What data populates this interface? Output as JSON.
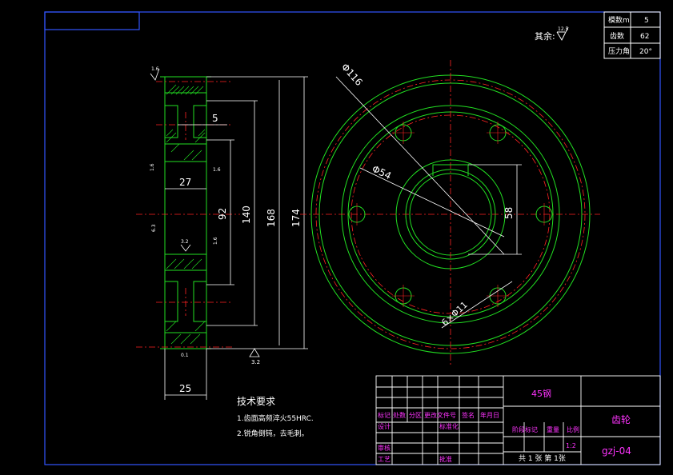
{
  "params": {
    "module_label": "模数m",
    "module_value": "5",
    "teeth_label": "齿数",
    "teeth_value": "62",
    "angle_label": "压力角",
    "angle_value": "20°"
  },
  "surface_note": {
    "label": "其余:",
    "roughness": "12.5"
  },
  "dims": {
    "d116": "Φ116",
    "d54": "Φ54",
    "holes": "6×Φ11",
    "v58": "58",
    "v5": "5",
    "v27": "27",
    "v92": "92",
    "v140": "140",
    "v168": "168",
    "v174": "174",
    "v25": "25"
  },
  "roughness_marks": {
    "top": "1.6",
    "left_mid": "1.6",
    "small_right": "1.6",
    "small_a": "3.2",
    "small_b": "1.6",
    "left_lower": "6.3",
    "bottom_left": "0.1",
    "bottom_center": "3.2"
  },
  "tech": {
    "title": "技术要求",
    "line1": "1.齿面高频淬火55HRC.",
    "line2": "2.锐角倒钝，去毛刺。"
  },
  "title_block": {
    "material": "45钢",
    "part_name": "齿轮",
    "drawing_no": "gzj-04",
    "scale": "1:2",
    "sheet": "共 1 张 第 1张",
    "col_mark": "标记",
    "col_count": "处数",
    "col_zone": "分区",
    "col_docno": "更改文件号",
    "col_sign": "签名",
    "col_date": "年月日",
    "row_design": "设计",
    "row_std": "标准化",
    "stage_mark": "阶段标记",
    "weight": "重量",
    "ratio": "比例",
    "row_review": "审核",
    "row_process": "工艺",
    "row_approve": "批准"
  }
}
